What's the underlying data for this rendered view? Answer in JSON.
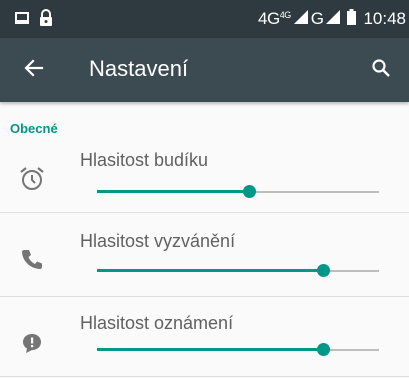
{
  "status_bar": {
    "network_1": "4G",
    "network_1_sup": "4G",
    "network_2": "G",
    "time": "10:48",
    "icons": [
      "notification-image-icon",
      "lock-icon",
      "signal-icon",
      "signal-icon",
      "battery-icon"
    ]
  },
  "app_bar": {
    "title": "Nastavení",
    "back_icon": "arrow-back-icon",
    "search_icon": "search-icon"
  },
  "section": {
    "title": "Obecné"
  },
  "settings": [
    {
      "label": "Hlasitost budíku",
      "icon": "alarm-clock-icon",
      "value": 0.54
    },
    {
      "label": "Hlasitost vyzvánění",
      "icon": "phone-icon",
      "value": 0.8
    },
    {
      "label": "Hlasitost oznámení",
      "icon": "notification-alert-icon",
      "value": 0.8
    }
  ],
  "colors": {
    "status_bar": "#2e3a40",
    "app_bar": "#3c4a51",
    "accent": "#009688",
    "background": "#fafafa"
  }
}
